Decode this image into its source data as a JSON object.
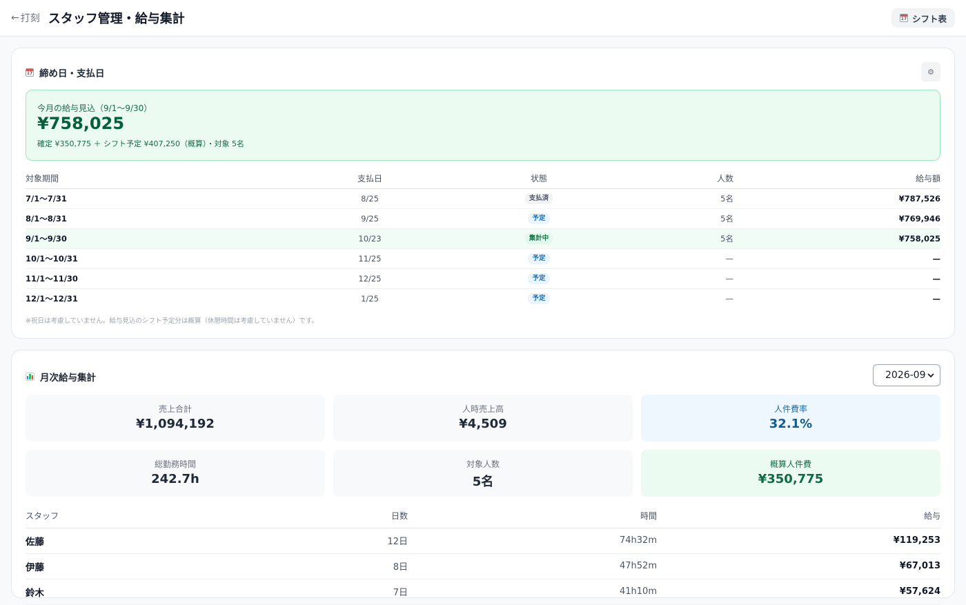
{
  "header": {
    "back_label": "打刻",
    "back_arrow": "←",
    "title": "スタッフ管理・給与集計",
    "shift_button_label": "シフト表",
    "calendar_icon_num": "17"
  },
  "closing": {
    "title": "締め日・支払日",
    "settings_icon": "⚙",
    "forecast": {
      "label": "今月の給与見込（9/1〜9/30）",
      "amount": "¥758,025",
      "detail": "確定 ¥350,775 ＋ シフト予定 ¥407,250（概算）・対象 5名"
    },
    "columns": [
      "対象期間",
      "支払日",
      "状態",
      "人数",
      "給与額"
    ],
    "rows": [
      {
        "period": "7/1〜7/31",
        "pay_date": "8/25",
        "status": "支払済",
        "status_type": "paid",
        "count": "5名",
        "amount": "¥787,526"
      },
      {
        "period": "8/1〜8/31",
        "pay_date": "9/25",
        "status": "予定",
        "status_type": "plan",
        "count": "5名",
        "amount": "¥769,946"
      },
      {
        "period": "9/1〜9/30",
        "pay_date": "10/23",
        "status": "集計中",
        "status_type": "active",
        "count": "5名",
        "amount": "¥758,025"
      },
      {
        "period": "10/1〜10/31",
        "pay_date": "11/25",
        "status": "予定",
        "status_type": "plan",
        "count": "—",
        "amount": "—"
      },
      {
        "period": "11/1〜11/30",
        "pay_date": "12/25",
        "status": "予定",
        "status_type": "plan",
        "count": "—",
        "amount": "—"
      },
      {
        "period": "12/1〜12/31",
        "pay_date": "1/25",
        "status": "予定",
        "status_type": "plan",
        "count": "—",
        "amount": "—"
      }
    ],
    "note": "※祝日は考慮していません。給与見込のシフト予定分は概算（休憩時間は考慮していません）です。"
  },
  "monthly": {
    "title": "月次給与集計",
    "month_value": "2026-09",
    "stats": [
      {
        "label": "売上合計",
        "value": "¥1,094,192",
        "tone": "gray"
      },
      {
        "label": "人時売上高",
        "value": "¥4,509",
        "tone": "gray"
      },
      {
        "label": "人件費率",
        "value": "32.1%",
        "tone": "blue"
      },
      {
        "label": "総勤務時間",
        "value": "242.7h",
        "tone": "gray"
      },
      {
        "label": "対象人数",
        "value": "5名",
        "tone": "gray"
      },
      {
        "label": "概算人件費",
        "value": "¥350,775",
        "tone": "green"
      }
    ],
    "columns": [
      "スタッフ",
      "日数",
      "時間",
      "給与"
    ],
    "staff": [
      {
        "name": "佐藤",
        "days": "12日",
        "hours": "74h32m",
        "pay": "¥119,253"
      },
      {
        "name": "伊藤",
        "days": "8日",
        "hours": "47h52m",
        "pay": "¥67,013"
      },
      {
        "name": "鈴木",
        "days": "7日",
        "hours": "41h10m",
        "pay": "¥57,624"
      }
    ]
  },
  "colors": {
    "accent_green": "#0f7a47",
    "accent_blue": "#1d6fb8",
    "forecast_bg": "#ebfbf2"
  }
}
